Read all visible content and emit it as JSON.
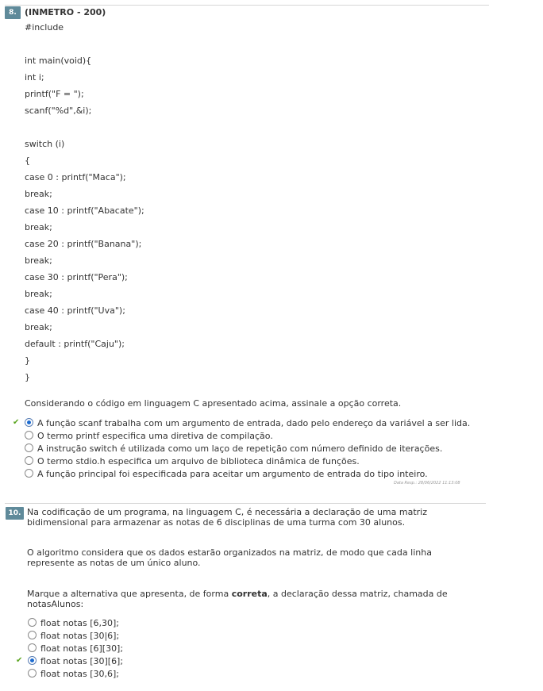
{
  "question8": {
    "number": "8.",
    "title": "(INMETRO - 200)",
    "code": [
      "#include",
      "",
      "int main(void){",
      "int i;",
      "printf(\"F = \");",
      "scanf(\"%d\",&i);",
      "",
      "switch (i)",
      "{",
      "case 0 : printf(\"Maca\");",
      "break;",
      "case 10 : printf(\"Abacate\");",
      "break;",
      "case 20 : printf(\"Banana\");",
      "break;",
      "case 30 : printf(\"Pera\");",
      "break;",
      "case 40 : printf(\"Uva\");",
      "break;",
      "default : printf(\"Caju\");",
      "}",
      "}"
    ],
    "prompt": "Considerando o código em linguagem C apresentado acima, assinale a opção correta.",
    "options": [
      "A função scanf trabalha com um argumento de entrada, dado pelo endereço da variável a ser lida.",
      "O termo printf especifica uma diretiva de compilação.",
      "A instrução switch é utilizada como um laço de repetição com número definido de iterações.",
      "O termo stdio.h especifica um arquivo de biblioteca dinâmica de funções.",
      "A função principal foi especificada para aceitar um argumento de entrada do tipo inteiro."
    ],
    "selected_index": 0,
    "correct_index": 0,
    "response_date": "Data Resp.: 28/06/2022 11:13:08"
  },
  "question10": {
    "number": "10.",
    "statement_1": "Na codificação de um programa, na linguagem C, é necessária a declaração de uma matriz bidimensional para armazenar as notas de 6 disciplinas de uma turma com 30 alunos.",
    "statement_2": "O algoritmo considera que os dados estarão organizados na matriz, de modo que cada linha represente as notas de um único aluno.",
    "statement_3_pre": "Marque a alternativa que apresenta, de forma ",
    "statement_3_bold": "correta",
    "statement_3_post": ", a declaração dessa matriz, chamada de notasAlunos:",
    "options": [
      "float notas [6,30];",
      "float notas [30|6];",
      "float notas [6][30];",
      "float notas [30][6];",
      "float notas [30,6];"
    ],
    "selected_index": 3,
    "correct_index": 3
  },
  "colors": {
    "badge": "#5f8a9a",
    "check": "#5aa520",
    "radio_selected": "#1c6bd0"
  },
  "icons": {
    "correct_mark": "check-icon"
  }
}
